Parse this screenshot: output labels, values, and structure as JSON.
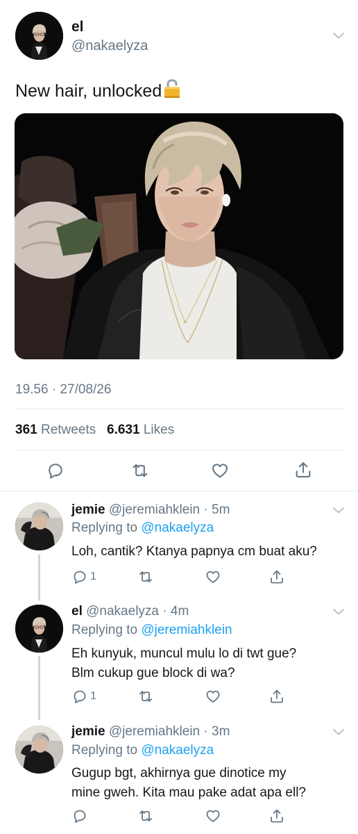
{
  "tweet": {
    "author_name": "el",
    "author_handle": "@nakaelyza",
    "text": "New hair, unlocked",
    "text_emoji": "open-lock-emoji",
    "timestamp": "19.56 · 27/08/26",
    "retweets_count": "361",
    "retweets_label": "Retweets",
    "likes_count": "6.631",
    "likes_label": "Likes",
    "actions": [
      "reply-icon",
      "retweet-icon",
      "like-icon",
      "share-icon"
    ]
  },
  "replies": [
    {
      "name": "jemie",
      "handle": "@jeremiahklein",
      "time": "5m",
      "replying_label": "Replying to",
      "replying_to": "@nakaelyza",
      "text_lines": [
        "Loh, cantik? Ktanya papnya cm buat aku?"
      ],
      "reply_count": "1"
    },
    {
      "name": "el",
      "handle": "@nakaelyza",
      "time": "4m",
      "replying_label": "Replying to",
      "replying_to": "@jeremiahklein",
      "text_lines": [
        "Eh kunyuk, muncul mulu lo di twt gue?",
        "Blm cukup gue block di wa?"
      ],
      "reply_count": "1"
    },
    {
      "name": "jemie",
      "handle": "@jeremiahklein",
      "time": "3m",
      "replying_label": "Replying to",
      "replying_to": "@nakaelyza",
      "text_lines": [
        "Gugup bgt, akhirnya gue dinotice my",
        "mine gweh. Kita mau pake adat apa ell?"
      ],
      "reply_count": ""
    }
  ],
  "colors": {
    "text": "#14171a",
    "secondary": "#657786",
    "link": "#1da1f2",
    "divider": "#e1e8ed"
  }
}
